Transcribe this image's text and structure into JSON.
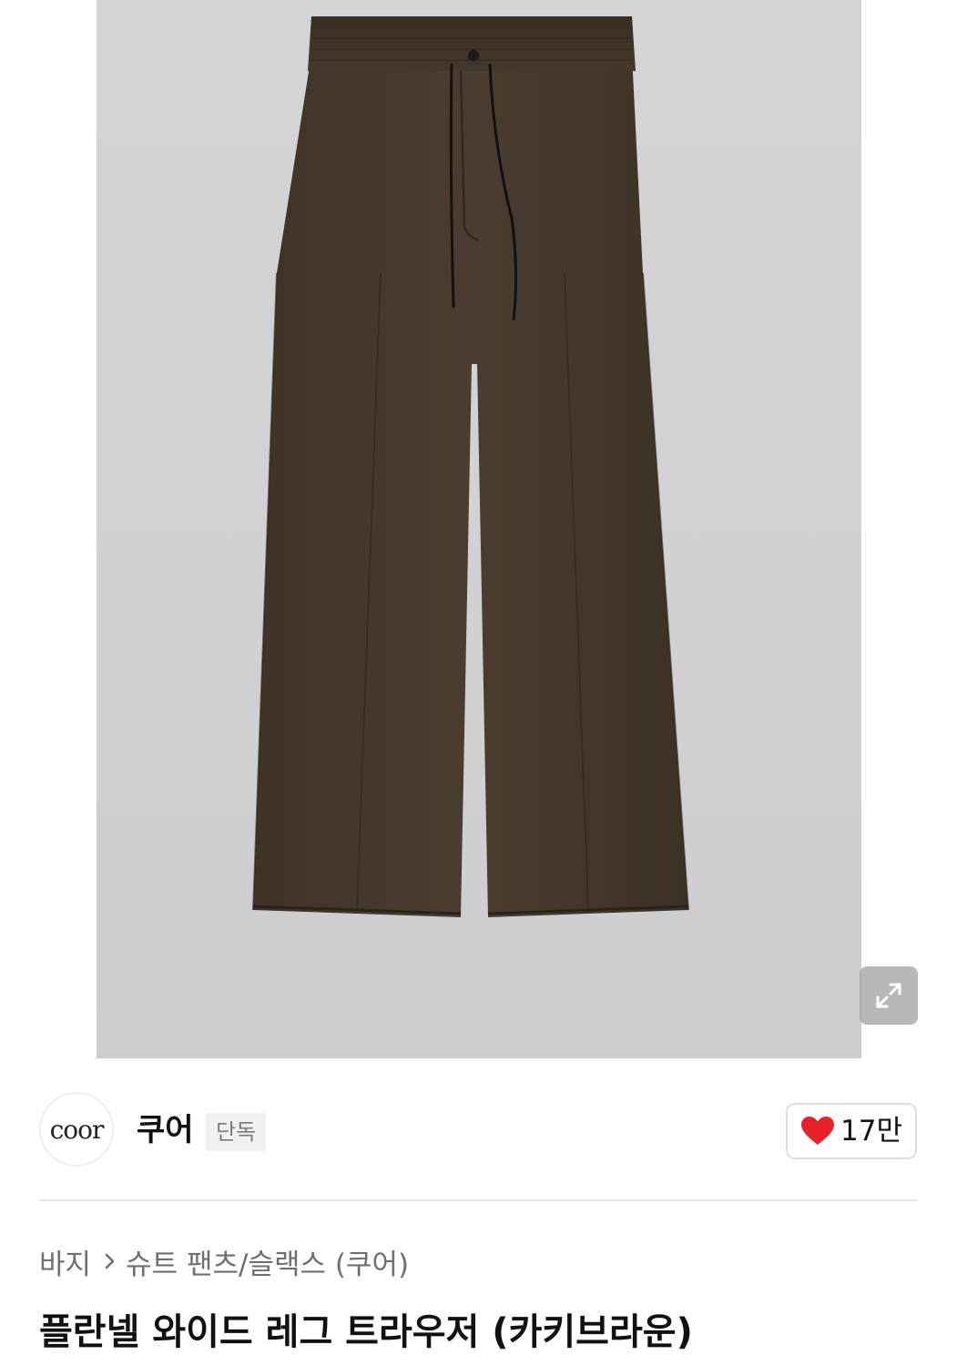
{
  "product_image": {
    "subject": "brown wide-leg trousers with drawstring waist"
  },
  "expand_button": {
    "icon": "expand-arrows-icon"
  },
  "brand": {
    "logo_text": "coor",
    "name": "쿠어",
    "badge": "단독"
  },
  "like": {
    "icon": "heart-icon",
    "count": "17만",
    "color": "#e8222a"
  },
  "breadcrumb": {
    "level1": "바지",
    "level2": "슈트 팬츠/슬랙스 (쿠어)"
  },
  "product": {
    "title": "플란넬 와이드 레그 트라우저 (카키브라운)"
  }
}
